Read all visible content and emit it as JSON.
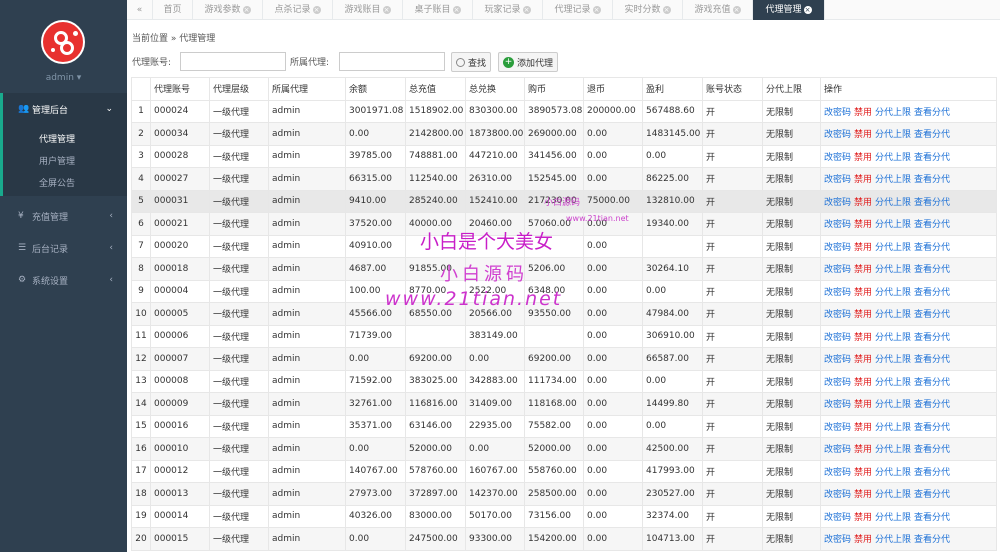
{
  "sidebar": {
    "user": "admin ▾",
    "sections": [
      {
        "icon": "users-icon",
        "label": "管理后台",
        "expanded": true,
        "items": [
          {
            "label": "代理管理",
            "active": true
          },
          {
            "label": "用户管理"
          },
          {
            "label": "全屏公告"
          }
        ]
      },
      {
        "icon": "yen-icon",
        "label": "充值管理"
      },
      {
        "icon": "list-icon",
        "label": "后台记录"
      },
      {
        "icon": "gears-icon",
        "label": "系统设置"
      }
    ]
  },
  "tabs": [
    {
      "label": "«"
    },
    {
      "label": "首页"
    },
    {
      "label": "游戏参数",
      "close": "×"
    },
    {
      "label": "点杀记录",
      "close": "×"
    },
    {
      "label": "游戏账目",
      "close": "×"
    },
    {
      "label": "桌子账目",
      "close": "×"
    },
    {
      "label": "玩家记录",
      "close": "×"
    },
    {
      "label": "代理记录",
      "close": "×"
    },
    {
      "label": "实时分数",
      "close": "×"
    },
    {
      "label": "游戏充值",
      "close": "×"
    },
    {
      "label": "代理管理",
      "close": "×",
      "active": true
    }
  ],
  "breadcrumb": "当前位置 » 代理管理",
  "filters": {
    "account_label": "代理账号:",
    "account_value": "",
    "parent_label": "所属代理:",
    "parent_value": "",
    "search_label": "查找",
    "add_label": "添加代理"
  },
  "table": {
    "columns": [
      "",
      "代理账号",
      "代理层级",
      "所属代理",
      "余额",
      "总充值",
      "总兑换",
      "购币",
      "退币",
      "盈利",
      "账号状态",
      "分代上限",
      "操作"
    ],
    "actions": [
      "改密码",
      "禁用",
      "分代上限",
      "查看分代"
    ],
    "rows": [
      [
        "1",
        "000024",
        "一级代理",
        "admin",
        "3001971.08",
        "1518902.00",
        "830300.00",
        "3890573.08",
        "200000.00",
        "567488.60",
        "开",
        "无限制"
      ],
      [
        "2",
        "000034",
        "一级代理",
        "admin",
        "0.00",
        "2142800.00",
        "1873800.00",
        "269000.00",
        "0.00",
        "1483145.00",
        "开",
        "无限制"
      ],
      [
        "3",
        "000028",
        "一级代理",
        "admin",
        "39785.00",
        "748881.00",
        "447210.00",
        "341456.00",
        "0.00",
        "0.00",
        "开",
        "无限制"
      ],
      [
        "4",
        "000027",
        "一级代理",
        "admin",
        "66315.00",
        "112540.00",
        "26310.00",
        "152545.00",
        "0.00",
        "86225.00",
        "开",
        "无限制"
      ],
      [
        "5",
        "000031",
        "一级代理",
        "admin",
        "9410.00",
        "285240.00",
        "152410.00",
        "217230.00",
        "75000.00",
        "132810.00",
        "开",
        "无限制"
      ],
      [
        "6",
        "000021",
        "一级代理",
        "admin",
        "37520.00",
        "40000.00",
        "20460.00",
        "57060.00",
        "0.00",
        "19340.00",
        "开",
        "无限制"
      ],
      [
        "7",
        "000020",
        "一级代理",
        "admin",
        "40910.00",
        "",
        "",
        "",
        "0.00",
        "",
        "开",
        "无限制"
      ],
      [
        "8",
        "000018",
        "一级代理",
        "admin",
        "4687.00",
        "91855.00",
        "",
        "5206.00",
        "0.00",
        "30264.10",
        "开",
        "无限制"
      ],
      [
        "9",
        "000004",
        "一级代理",
        "admin",
        "100.00",
        "8770.00",
        "2522.00",
        "6348.00",
        "0.00",
        "0.00",
        "开",
        "无限制"
      ],
      [
        "10",
        "000005",
        "一级代理",
        "admin",
        "45566.00",
        "68550.00",
        "20566.00",
        "93550.00",
        "0.00",
        "47984.00",
        "开",
        "无限制"
      ],
      [
        "11",
        "000006",
        "一级代理",
        "admin",
        "71739.00",
        "",
        "383149.00",
        "",
        "0.00",
        "306910.00",
        "开",
        "无限制"
      ],
      [
        "12",
        "000007",
        "一级代理",
        "admin",
        "0.00",
        "69200.00",
        "0.00",
        "69200.00",
        "0.00",
        "66587.00",
        "开",
        "无限制"
      ],
      [
        "13",
        "000008",
        "一级代理",
        "admin",
        "71592.00",
        "383025.00",
        "342883.00",
        "111734.00",
        "0.00",
        "0.00",
        "开",
        "无限制"
      ],
      [
        "14",
        "000009",
        "一级代理",
        "admin",
        "32761.00",
        "116816.00",
        "31409.00",
        "118168.00",
        "0.00",
        "14499.80",
        "开",
        "无限制"
      ],
      [
        "15",
        "000016",
        "一级代理",
        "admin",
        "35371.00",
        "63146.00",
        "22935.00",
        "75582.00",
        "0.00",
        "0.00",
        "开",
        "无限制"
      ],
      [
        "16",
        "000010",
        "一级代理",
        "admin",
        "0.00",
        "52000.00",
        "0.00",
        "52000.00",
        "0.00",
        "42500.00",
        "开",
        "无限制"
      ],
      [
        "17",
        "000012",
        "一级代理",
        "admin",
        "140767.00",
        "578760.00",
        "160767.00",
        "558760.00",
        "0.00",
        "417993.00",
        "开",
        "无限制"
      ],
      [
        "18",
        "000013",
        "一级代理",
        "admin",
        "27973.00",
        "372897.00",
        "142370.00",
        "258500.00",
        "0.00",
        "230527.00",
        "开",
        "无限制"
      ],
      [
        "19",
        "000014",
        "一级代理",
        "admin",
        "40326.00",
        "83000.00",
        "50170.00",
        "73156.00",
        "0.00",
        "32374.00",
        "开",
        "无限制"
      ],
      [
        "20",
        "000015",
        "一级代理",
        "admin",
        "0.00",
        "247500.00",
        "93300.00",
        "154200.00",
        "0.00",
        "104713.00",
        "开",
        "无限制"
      ]
    ]
  },
  "watermark": {
    "line1": "小白是个大美女",
    "line2": "小白源码",
    "line3": "www.21tian.net",
    "small_label": "小白源码",
    "small_url": "www.21tian.net"
  },
  "colors": {
    "sidebar": "#2f4050",
    "accent": "#19aa8d",
    "link": "#1a6fd6",
    "danger": "#e02020",
    "logo": "#e8312f",
    "watermark": "#cc33cc"
  }
}
